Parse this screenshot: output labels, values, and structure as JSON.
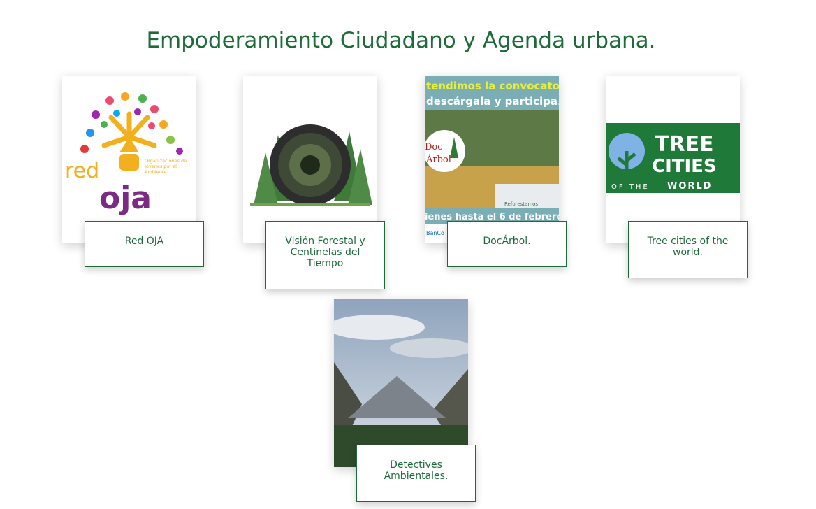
{
  "page": {
    "heading": "Empoderamiento Ciudadano y Agenda urbana."
  },
  "cards": [
    {
      "label": "Red OJA",
      "image_text": {
        "word1": "red",
        "word2": "oja",
        "subtitle_line1": "Organizaciones de",
        "subtitle_line2": "Jóvenes por el",
        "subtitle_line3": "Ambiente"
      }
    },
    {
      "label": "Visión Forestal y Centinelas del Tiempo"
    },
    {
      "label": "DocÁrbol.",
      "image_text": {
        "banner1": "tendimos la convocator",
        "banner2": "descárgala y participa.",
        "logo1": "Doc",
        "logo2": "Árbol",
        "sponsor": "Reforestamos",
        "footer": "ienes hasta el 6 de febrero",
        "footer2": "BanCo"
      }
    },
    {
      "label": "Tree cities of the world.",
      "image_text": {
        "line1": "TREE",
        "line2": "CITIES",
        "line3": "OF THE",
        "line4": "WORLD"
      }
    },
    {
      "label": "Detectives Ambientales."
    }
  ],
  "colors": {
    "accent": "#1e6b3a",
    "background": "#ffffff"
  }
}
